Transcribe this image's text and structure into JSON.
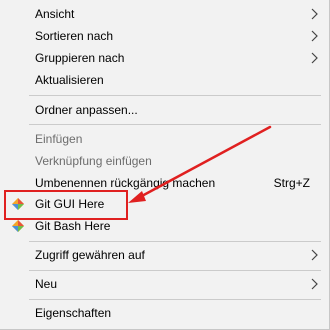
{
  "menu": {
    "items": {
      "ansicht": {
        "label": "Ansicht"
      },
      "sortieren": {
        "label": "Sortieren nach"
      },
      "gruppieren": {
        "label": "Gruppieren nach"
      },
      "aktualisieren": {
        "label": "Aktualisieren"
      },
      "ordner": {
        "label": "Ordner anpassen..."
      },
      "einfuegen": {
        "label": "Einfügen"
      },
      "verknuepfung": {
        "label": "Verknüpfung einfügen"
      },
      "umbenennen": {
        "label": "Umbenennen rückgängig machen",
        "shortcut": "Strg+Z"
      },
      "gitgui": {
        "label": "Git GUI Here",
        "icon": "git-icon"
      },
      "gitbash": {
        "label": "Git Bash Here",
        "icon": "git-icon"
      },
      "zugriff": {
        "label": "Zugriff gewähren auf"
      },
      "neu": {
        "label": "Neu"
      },
      "eigenschaften": {
        "label": "Eigenschaften"
      }
    }
  },
  "colors": {
    "menu_background": "#f2f2f2",
    "disabled_text": "#6d6d6d",
    "annotation": "#e02020"
  }
}
